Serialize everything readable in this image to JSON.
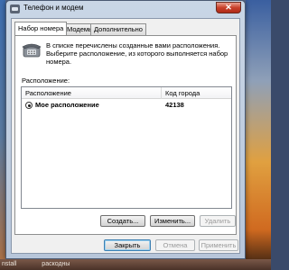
{
  "window": {
    "title": "Телефон и модем",
    "close_glyph": "✕"
  },
  "tabs": [
    {
      "label": "Набор номера",
      "active": true
    },
    {
      "label": "Модемы",
      "active": false
    },
    {
      "label": "Дополнительно",
      "active": false
    }
  ],
  "dialing": {
    "intro": "В списке перечислены созданные вами расположения. Выберите расположение, из которого выполняется набор номера.",
    "locations_label": "Расположение:",
    "columns": {
      "location": "Расположение",
      "area_code": "Код города"
    },
    "rows": [
      {
        "name": "Мое расположение",
        "area_code": "42138",
        "selected": true
      }
    ],
    "buttons": {
      "create": "Создать...",
      "edit": "Изменить...",
      "delete": "Удалить"
    }
  },
  "footer": {
    "ok": "Закрыть",
    "cancel": "Отмена",
    "apply": "Применить"
  },
  "taskbar": {
    "items": [
      "nstall",
      "раскодны"
    ]
  }
}
